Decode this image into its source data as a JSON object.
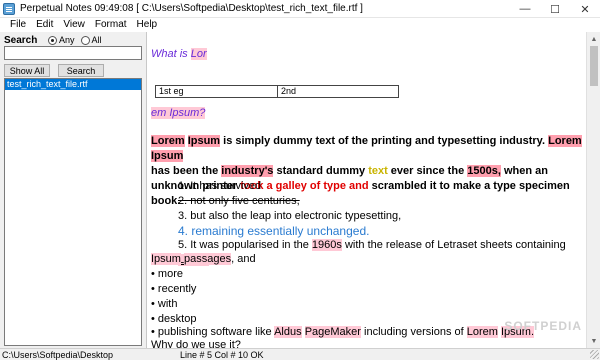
{
  "window": {
    "title": "Perpetual Notes 09:49:08 [ C:\\Users\\Softpedia\\Desktop\\test_rich_text_file.rtf ]",
    "minimize": "—",
    "maximize": "☐",
    "close": "✕"
  },
  "menu": [
    "File",
    "Edit",
    "View",
    "Format",
    "Help"
  ],
  "sidebar": {
    "search_label": "Search",
    "radio_any": "Any",
    "radio_all": "All",
    "selected_radio": "Any",
    "search_value": "",
    "show_all": "Show All",
    "search_button": "Search",
    "notes": [
      "test_rich_text_file.rtf"
    ],
    "path": "C:\\Users\\Softpedia\\Desktop"
  },
  "editor": {
    "heading1_a": "What is ",
    "heading1_b": "Lor",
    "table": [
      "1st eg",
      "2nd"
    ],
    "heading2_a": "em ",
    "heading2_b": "Ipsum?",
    "para": {
      "w1": "Lorem",
      "w2": "Ipsum",
      "t1": " is simply dummy text of the printing and typesetting industry. ",
      "w3": "Lorem",
      "w4": "Ipsum",
      "t2": "has been the ",
      "w5": "industry's",
      "t3": " standard dummy ",
      "w6": "text",
      "t4": " ever since the ",
      "w7": "1500s,",
      "t5": " when an unknown printer ",
      "w8": "took a galley of type and",
      "t6": " scrambled it to make a type specimen book."
    },
    "list": {
      "i1": "1. It has survived",
      "i2": "2. not only five centuries,",
      "i3": "3. but also the leap into electronic typesetting,",
      "i4": "4. remaining essentially unchanged.",
      "i5a": "5. It was popularised in the ",
      "i5b": "1960s",
      "i5c": " with the release of Letraset sheets containing ",
      "i5d": "Lorem",
      "i5e": "Ipsum",
      "i5f": "passages",
      "i5g": ", and"
    },
    "bullets": [
      "• more",
      "• recently",
      "• with",
      "• desktop"
    ],
    "bullet5": {
      "a": "• publishing software like ",
      "b": "Aldus",
      "c": "PageMaker",
      "d": " including versions of ",
      "e": "Lorem",
      "f": "Ipsum."
    },
    "last_line": "Why do we use it?"
  },
  "status": {
    "position": "Line # 5 Col # 10  OK"
  },
  "watermark": "SOFTPEDIA",
  "colors": {
    "accent_purple": "#6a2bd9",
    "highlight_pink": "#ffc9d6",
    "selection_blue": "#0078d7",
    "red_text": "#e00000",
    "blue_text": "#2a7bd0"
  }
}
